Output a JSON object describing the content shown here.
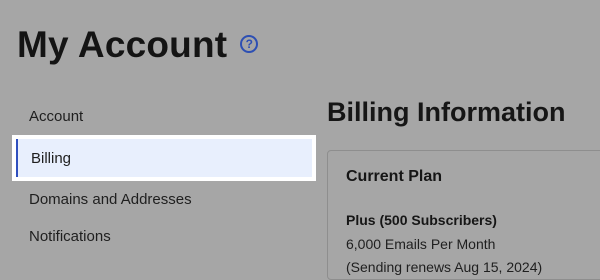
{
  "header": {
    "title": "My Account",
    "help_icon": "question-circle-icon",
    "help_glyph": "?"
  },
  "sidebar": {
    "items": [
      {
        "label": "Account",
        "active": false
      },
      {
        "label": "Billing",
        "active": true
      },
      {
        "label": "Domains and Addresses",
        "active": false
      },
      {
        "label": "Notifications",
        "active": false
      }
    ]
  },
  "main": {
    "section_title": "Billing Information",
    "current_plan": {
      "title": "Current Plan",
      "plan_name": "Plus (500 Subscribers)",
      "emails_per_month": "6,000 Emails Per Month",
      "renewal": "(Sending renews Aug 15, 2024)"
    }
  },
  "colors": {
    "accent": "#2f4fbf",
    "active_item_bg": "#e8effd",
    "backdrop": "#a6a6a6"
  }
}
